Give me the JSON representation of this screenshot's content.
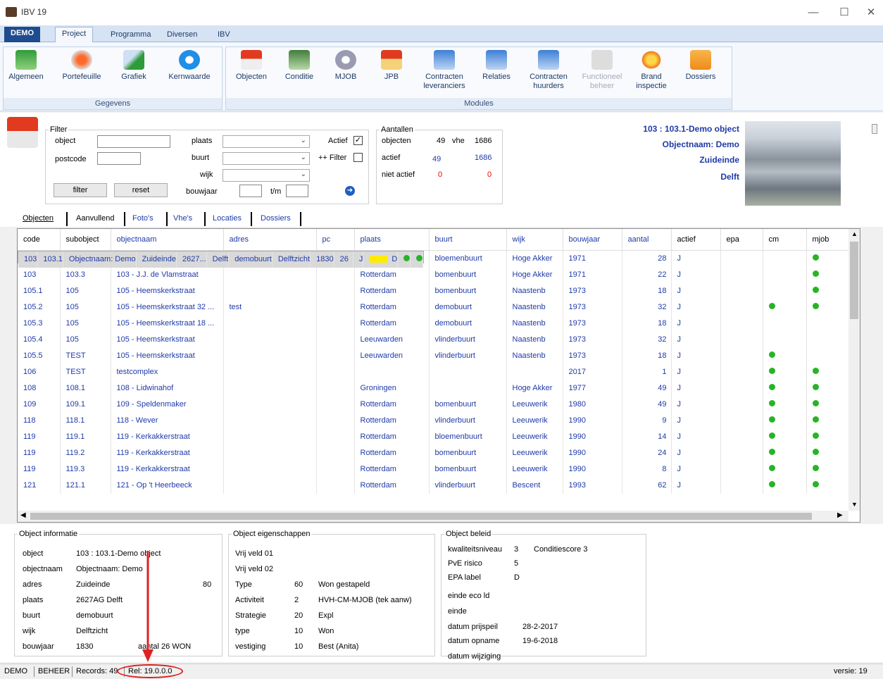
{
  "window": {
    "title": "IBV 19",
    "min": "—",
    "max": "☐",
    "close": "✕"
  },
  "menu": {
    "demo": "DEMO",
    "tabs": [
      "Project",
      "Programma",
      "Diversen",
      "IBV"
    ]
  },
  "ribbon": {
    "gegevens_label": "Gegevens",
    "modules_label": "Modules",
    "gegevens": [
      "Algemeen",
      "Portefeuille",
      "Grafiek",
      "Kernwaarde"
    ],
    "modules": [
      [
        "Objecten",
        ""
      ],
      [
        "Conditie",
        ""
      ],
      [
        "MJOB",
        ""
      ],
      [
        "JPB",
        ""
      ],
      [
        "Contracten",
        "leveranciers"
      ],
      [
        "Relaties",
        ""
      ],
      [
        "Contracten",
        "huurders"
      ],
      [
        "Functioneel",
        "beheer"
      ],
      [
        "Brand",
        "inspectie"
      ],
      [
        "Dossiers",
        ""
      ]
    ]
  },
  "filter": {
    "legend": "Filter",
    "object": "object",
    "postcode": "postcode",
    "plaats": "plaats",
    "buurt": "buurt",
    "wijk": "wijk",
    "bouwjaar": "bouwjaar",
    "tm": "t/m",
    "actief": "Actief",
    "actief_check": "✓",
    "plusfilter": "++ Filter",
    "filter_btn": "filter",
    "reset_btn": "reset",
    "go": "➜"
  },
  "aantallen": {
    "legend": "Aantallen",
    "objecten_lbl": "objecten",
    "objecten": "49",
    "vhe_lbl": "vhe",
    "vhe": "1686",
    "actief_lbl": "actief",
    "actief": "49",
    "actief_vhe": "1686",
    "niet_lbl": "niet actief",
    "niet": "0",
    "niet_vhe": "0"
  },
  "selected": {
    "line1": "103 : 103.1-Demo object",
    "line2": "Objectnaam: Demo",
    "line3": "Zuideinde",
    "line4": "Delft"
  },
  "tabs": [
    "Objecten",
    "Aanvullend",
    "Foto's",
    "Vhe's",
    "Locaties",
    "Dossiers"
  ],
  "grid": {
    "columns": [
      "code",
      "subobject",
      "objectnaam",
      "adres",
      "pc",
      "plaats",
      "buurt",
      "wijk",
      "bouwjaar",
      "aantal",
      "actief",
      "epa",
      "cm",
      "mjob"
    ],
    "rows": [
      [
        "103",
        "103.1",
        "Objectnaam: Demo",
        "Zuideinde",
        "2627...",
        "Delft",
        "demobuurt",
        "Delftzicht",
        "1830",
        "26",
        "J",
        "D",
        "1",
        "1"
      ],
      [
        "103",
        "103.2",
        "103 - J.J. de Vlamstraat",
        "",
        "",
        "Groningen",
        "bloemenbuurt",
        "Hoge Akker",
        "1971",
        "28",
        "J",
        "",
        "",
        "1"
      ],
      [
        "103",
        "103.3",
        "103 - J.J. de Vlamstraat",
        "",
        "",
        "Rotterdam",
        "bomenbuurt",
        "Hoge Akker",
        "1971",
        "22",
        "J",
        "",
        "",
        "1"
      ],
      [
        "105.1",
        "105",
        "105 - Heemskerkstraat",
        "",
        "",
        "Rotterdam",
        "bomenbuurt",
        "Naastenb",
        "1973",
        "18",
        "J",
        "",
        "",
        "1"
      ],
      [
        "105.2",
        "105",
        "105 - Heemskerkstraat 32 ...",
        "test",
        "",
        "Rotterdam",
        "demobuurt",
        "Naastenb",
        "1973",
        "32",
        "J",
        "",
        "1",
        "1"
      ],
      [
        "105.3",
        "105",
        "105 - Heemskerkstraat 18 ...",
        "",
        "",
        "Rotterdam",
        "demobuurt",
        "Naastenb",
        "1973",
        "18",
        "J",
        "",
        "",
        ""
      ],
      [
        "105.4",
        "105",
        "105 - Heemskerkstraat",
        "",
        "",
        "Leeuwarden",
        "vlinderbuurt",
        "Naastenb",
        "1973",
        "32",
        "J",
        "",
        "",
        ""
      ],
      [
        "105.5",
        "TEST",
        "105 - Heemskerkstraat",
        "",
        "",
        "Leeuwarden",
        "vlinderbuurt",
        "Naastenb",
        "1973",
        "18",
        "J",
        "",
        "1",
        ""
      ],
      [
        "106",
        "TEST",
        "testcomplex",
        "",
        "",
        "",
        "",
        "",
        "2017",
        "1",
        "J",
        "",
        "1",
        "1"
      ],
      [
        "108",
        "108.1",
        "108 - Lidwinahof",
        "",
        "",
        "Groningen",
        "",
        "Hoge Akker",
        "1977",
        "49",
        "J",
        "",
        "1",
        "1"
      ],
      [
        "109",
        "109.1",
        "109 - Speldenmaker",
        "",
        "",
        "Rotterdam",
        "bomenbuurt",
        "Leeuwerik",
        "1980",
        "49",
        "J",
        "",
        "1",
        "1"
      ],
      [
        "118",
        "118.1",
        "118 - Wever",
        "",
        "",
        "Rotterdam",
        "vlinderbuurt",
        "Leeuwerik",
        "1990",
        "9",
        "J",
        "",
        "1",
        "1"
      ],
      [
        "119",
        "119.1",
        "119 - Kerkakkerstraat",
        "",
        "",
        "Rotterdam",
        "bloemenbuurt",
        "Leeuwerik",
        "1990",
        "14",
        "J",
        "",
        "1",
        "1"
      ],
      [
        "119",
        "119.2",
        "119 - Kerkakkerstraat",
        "",
        "",
        "Rotterdam",
        "bomenbuurt",
        "Leeuwerik",
        "1990",
        "24",
        "J",
        "",
        "1",
        "1"
      ],
      [
        "119",
        "119.3",
        "119 - Kerkakkerstraat",
        "",
        "",
        "Rotterdam",
        "bomenbuurt",
        "Leeuwerik",
        "1990",
        "8",
        "J",
        "",
        "1",
        "1"
      ],
      [
        "121",
        "121.1",
        "121 - Op 't Heerbeeck",
        "",
        "",
        "Rotterdam",
        "vlinderbuurt",
        "Bescent",
        "1993",
        "62",
        "J",
        "",
        "1",
        "1"
      ]
    ]
  },
  "info": {
    "legend": "Object informatie",
    "object_lbl": "object",
    "object": "103 : 103.1-Demo object",
    "naam_lbl": "objectnaam",
    "naam": "Objectnaam: Demo",
    "adres_lbl": "adres",
    "adres": "Zuideinde",
    "huisnr": "80",
    "plaats_lbl": "plaats",
    "plaats": "2627AG  Delft",
    "buurt_lbl": "buurt",
    "buurt": "demobuurt",
    "wijk_lbl": "wijk",
    "wijk": "Delftzicht",
    "bouwjaar_lbl": "bouwjaar",
    "bouwjaar": "1830",
    "aantal": "aantal  26 WON"
  },
  "eigen": {
    "legend": "Object eigenschappen",
    "vrij1": "Vrij veld 01",
    "vrij2": "Vrij veld 02",
    "rows": [
      [
        "Type",
        "60",
        "Won gestapeld"
      ],
      [
        "Activiteit",
        "2",
        "HVH-CM-MJOB (tek aanw)"
      ],
      [
        "Strategie",
        "20",
        "Expl"
      ],
      [
        "type",
        "10",
        "Won"
      ],
      [
        "vestiging",
        "10",
        "Best (Anita)"
      ]
    ]
  },
  "beleid": {
    "legend": "Object beleid",
    "rows": [
      [
        "kwaliteitsniveau",
        "3",
        "Conditiescore 3"
      ],
      [
        "PvE risico",
        "5",
        ""
      ],
      [
        "EPA label",
        "D",
        ""
      ],
      [
        "einde eco ld",
        "",
        ""
      ],
      [
        "einde",
        "",
        ""
      ],
      [
        "datum prijspeil",
        "28-2-2017",
        ""
      ],
      [
        "datum opname",
        "19-6-2018",
        ""
      ],
      [
        "datum wijziging",
        "",
        ""
      ]
    ]
  },
  "status": {
    "demo": "DEMO",
    "beheer": "BEHEER",
    "records": "Records: 49",
    "rel": "Rel: 19.0.0.0",
    "versie": "versie: 19"
  }
}
